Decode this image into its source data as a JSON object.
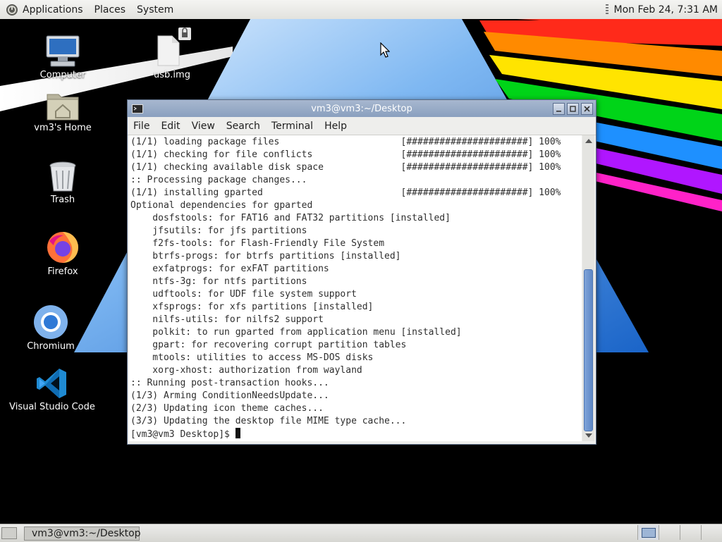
{
  "top_panel": {
    "menus": [
      "Applications",
      "Places",
      "System"
    ],
    "clock": "Mon Feb 24,  7:31 AM"
  },
  "desktop": {
    "icons": [
      {
        "label": "Computer",
        "icon": "computer-icon"
      },
      {
        "label": "usb.img",
        "icon": "file-icon"
      },
      {
        "label": "vm3's Home",
        "icon": "home-folder-icon"
      },
      {
        "label": "Trash",
        "icon": "trash-icon"
      },
      {
        "label": "Firefox",
        "icon": "firefox-icon"
      },
      {
        "label": "Chromium",
        "icon": "chromium-icon"
      },
      {
        "label": "Visual Studio Code",
        "icon": "vscode-icon"
      }
    ]
  },
  "terminal": {
    "title": "vm3@vm3:~/Desktop",
    "menu": [
      "File",
      "Edit",
      "View",
      "Search",
      "Terminal",
      "Help"
    ],
    "lines": [
      "(1/1) loading package files                      [######################] 100%",
      "(1/1) checking for file conflicts                [######################] 100%",
      "(1/1) checking available disk space              [######################] 100%",
      ":: Processing package changes...",
      "(1/1) installing gparted                         [######################] 100%",
      "Optional dependencies for gparted",
      "    dosfstools: for FAT16 and FAT32 partitions [installed]",
      "    jfsutils: for jfs partitions",
      "    f2fs-tools: for Flash-Friendly File System",
      "    btrfs-progs: for btrfs partitions [installed]",
      "    exfatprogs: for exFAT partitions",
      "    ntfs-3g: for ntfs partitions",
      "    udftools: for UDF file system support",
      "    xfsprogs: for xfs partitions [installed]",
      "    nilfs-utils: for nilfs2 support",
      "    polkit: to run gparted from application menu [installed]",
      "    gpart: for recovering corrupt partition tables",
      "    mtools: utilities to access MS-DOS disks",
      "    xorg-xhost: authorization from wayland",
      ":: Running post-transaction hooks...",
      "(1/3) Arming ConditionNeedsUpdate...",
      "(2/3) Updating icon theme caches...",
      "(3/3) Updating the desktop file MIME type cache..."
    ],
    "prompt": "[vm3@vm3 Desktop]$ "
  },
  "bottom_panel": {
    "task_label": "vm3@vm3:~/Desktop"
  }
}
